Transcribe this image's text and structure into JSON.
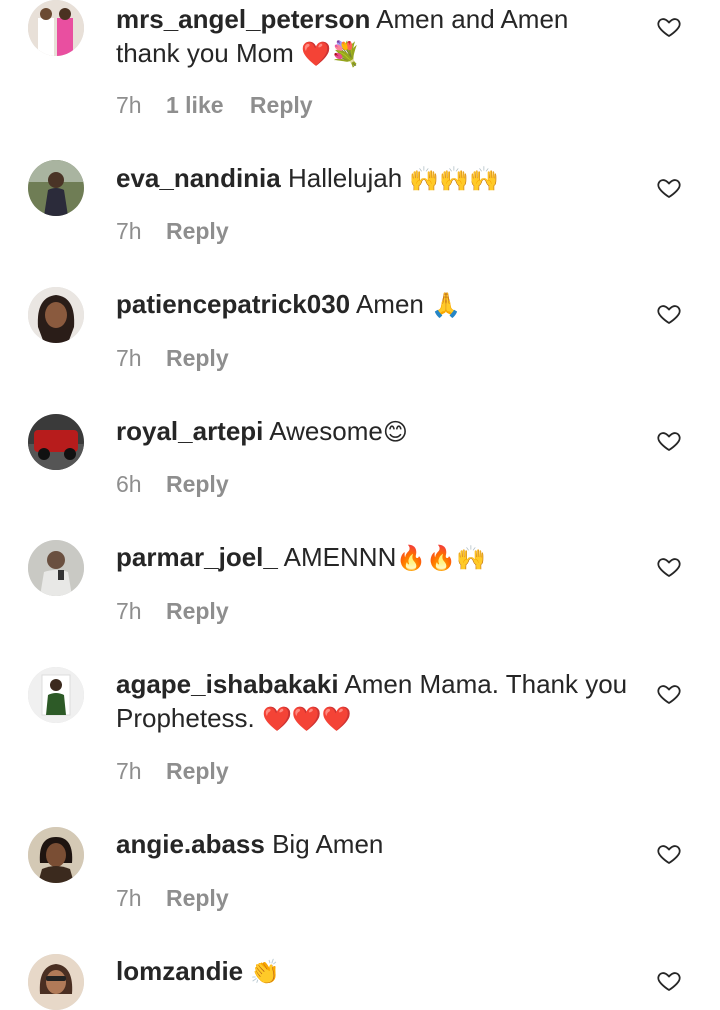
{
  "comments": [
    {
      "username": "mrs_angel_peterson",
      "text": "Amen and Amen thank you Mom",
      "emoji": "❤️💐",
      "time": "7h",
      "likes": "1 like",
      "reply": "Reply",
      "avatar_colors": [
        "#b08a6a",
        "#e94fa0"
      ]
    },
    {
      "username": "eva_nandinia",
      "text": "Hallelujah",
      "emoji": "🙌🙌🙌",
      "time": "7h",
      "reply": "Reply",
      "avatar_colors": [
        "#5a6b3c",
        "#2b2b3a"
      ]
    },
    {
      "username": "patiencepatrick030",
      "text": "Amen",
      "emoji": "🙏",
      "time": "7h",
      "reply": "Reply",
      "avatar_colors": [
        "#e8e4e0",
        "#2a1d18"
      ]
    },
    {
      "username": "royal_artepi",
      "text": "Awesome",
      "emoji": "😊",
      "time": "6h",
      "reply": "Reply",
      "avatar_colors": [
        "#b71c1c",
        "#3a3a3a"
      ]
    },
    {
      "username": "parmar_joel_",
      "text": "AMENNN",
      "emoji": "🔥🔥🙌",
      "time": "7h",
      "reply": "Reply",
      "avatar_colors": [
        "#c9c9c4",
        "#4a4a48"
      ]
    },
    {
      "username": "agape_ishabakaki",
      "text": "Amen Mama. Thank you Prophetess.",
      "emoji": "❤️❤️❤️",
      "time": "7h",
      "reply": "Reply",
      "avatar_colors": [
        "#f0f0f0",
        "#2d5a27"
      ]
    },
    {
      "username": "angie.abass",
      "text": "Big Amen",
      "emoji": "",
      "time": "7h",
      "reply": "Reply",
      "avatar_colors": [
        "#d4c9b5",
        "#3b2a1e"
      ]
    },
    {
      "username": "lomzandie",
      "text": "",
      "emoji": "👏",
      "avatar_colors": [
        "#e7d8c8",
        "#4a2f22"
      ]
    }
  ],
  "icons": {
    "like": "heart-outline-icon"
  },
  "colors": {
    "text": "#262626",
    "secondary": "#8e8e8e",
    "background": "#ffffff"
  }
}
